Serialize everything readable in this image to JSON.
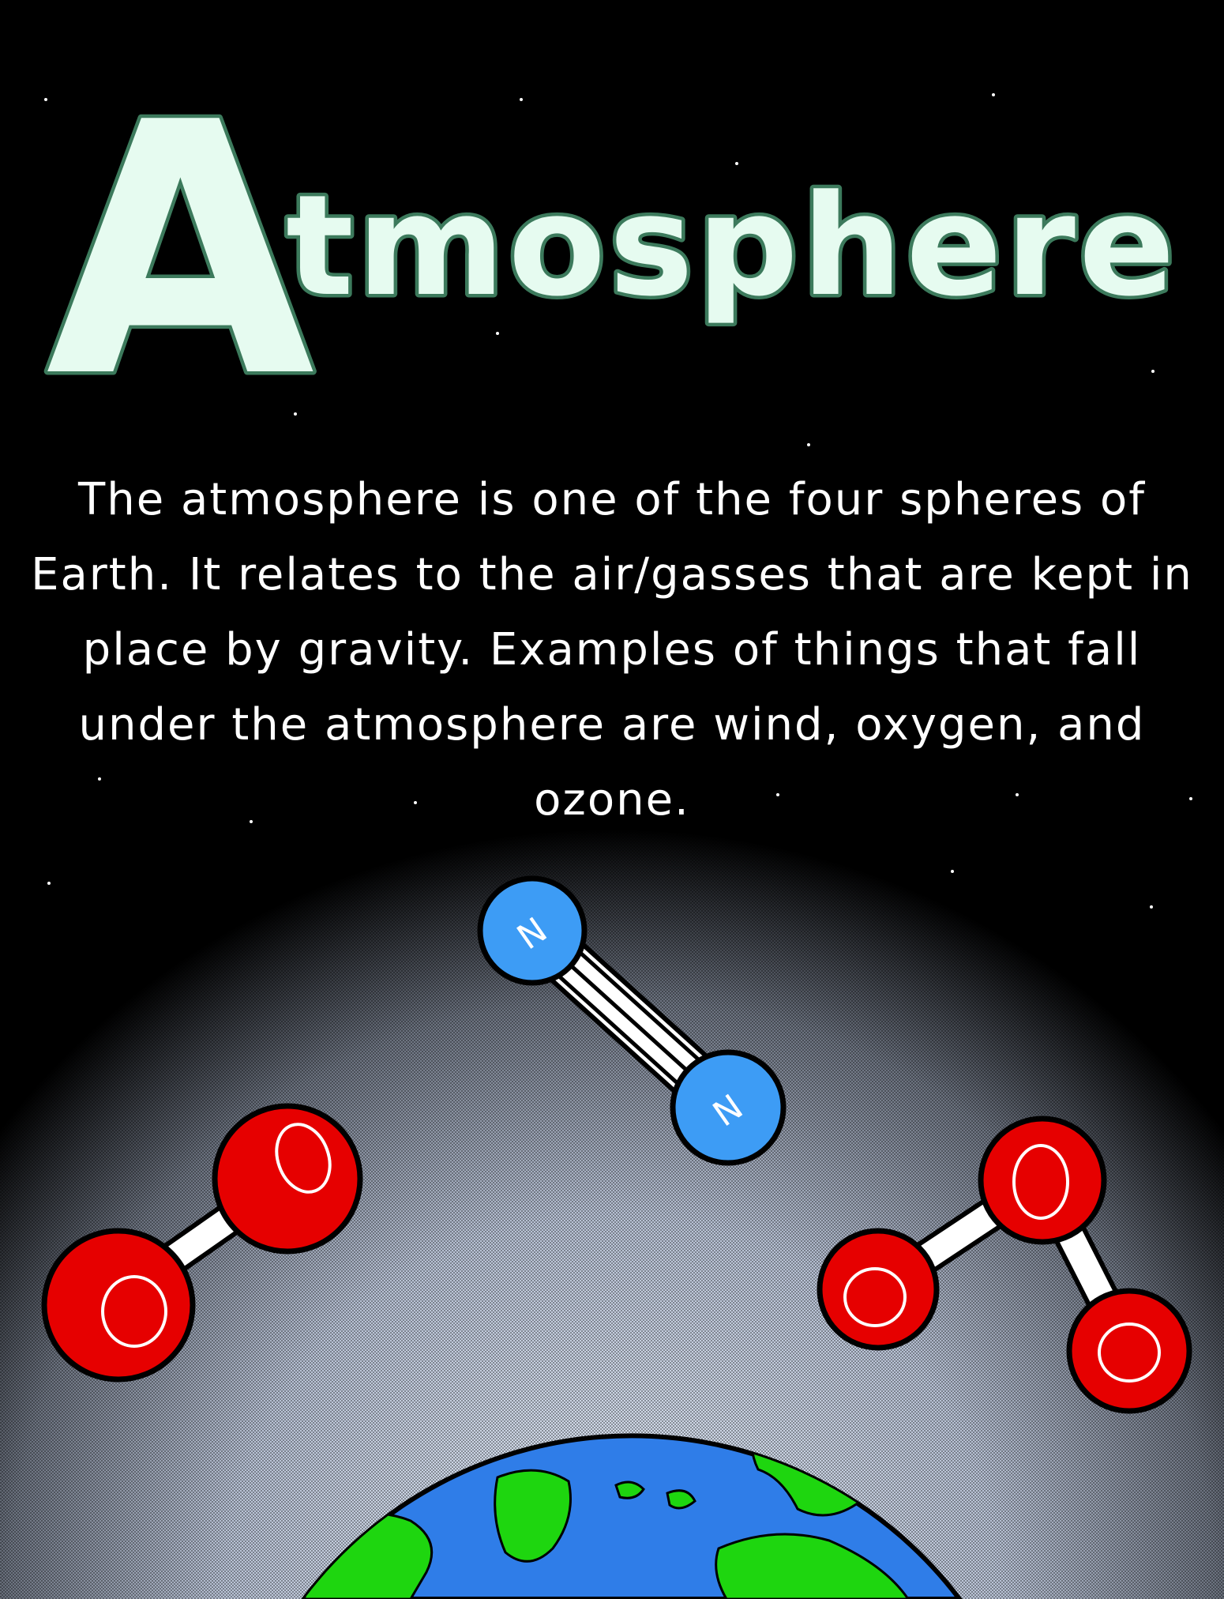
{
  "title": {
    "initial": "A",
    "rest": "tmosphere"
  },
  "description": "The atmosphere is one of the four spheres of Earth. It relates to the air/gasses that are kept in place by gravity. Examples of things that fall under the atmosphere are wind, oxygen, and ozone.",
  "molecules": {
    "nitrogen": {
      "atom_label": "N",
      "color": "#3d9cf5"
    },
    "oxygen": {
      "atom_label": "O",
      "color": "#e60000"
    },
    "ozone": {
      "atom_label": "O",
      "color": "#e60000"
    }
  },
  "colors": {
    "background": "#000000",
    "title_fill": "#e6fbf0",
    "title_outline": "#3c7a5c",
    "atmosphere_glow": "#c9d4e6",
    "ocean": "#2f7de8",
    "land": "#1ed60f",
    "ice": "#ffffff"
  }
}
